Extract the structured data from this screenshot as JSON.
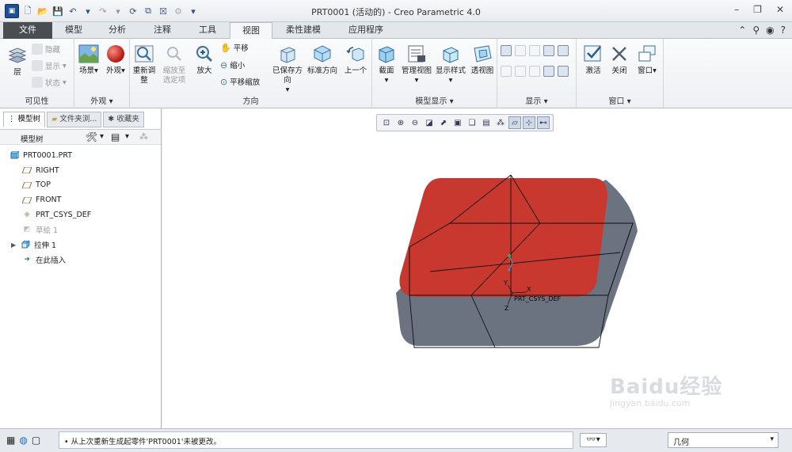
{
  "window": {
    "title": "PRT0001 (活动的) - Creo Parametric 4.0"
  },
  "tabs": [
    {
      "label": "文件"
    },
    {
      "label": "模型"
    },
    {
      "label": "分析"
    },
    {
      "label": "注释"
    },
    {
      "label": "工具"
    },
    {
      "label": "视图"
    },
    {
      "label": "柔性建模"
    },
    {
      "label": "应用程序"
    }
  ],
  "active_tab": "视图",
  "ribbon": {
    "visibility": {
      "label": "可见性",
      "layer": "层",
      "hide": "隐藏",
      "show": "显示",
      "status": "状态"
    },
    "appearance": {
      "label": "外观",
      "scene": "场景",
      "appearance": "外观"
    },
    "orientation": {
      "label": "方向",
      "refit": "重新调整",
      "zoom_selected": "缩放至选定项",
      "zoom_in": "放大",
      "pan": "平移",
      "zoom_out": "缩小",
      "pan_zoom": "平移缩放",
      "saved_orientations": "已保存方向",
      "standard_orientation": "标准方向",
      "previous": "上一个"
    },
    "model_display": {
      "label": "模型显示",
      "section": "截面",
      "manage_views": "管理视图",
      "display_style": "显示样式",
      "perspective": "透视图"
    },
    "show": {
      "label": "显示"
    },
    "window": {
      "label": "窗口",
      "activate": "激活",
      "close": "关闭",
      "windows": "窗口"
    }
  },
  "left_panel": {
    "tabs": [
      {
        "label": "模型树"
      },
      {
        "label": "文件夹浏..."
      },
      {
        "label": "收藏夹"
      }
    ],
    "tree_header": "模型树",
    "tree": [
      {
        "label": "PRT0001.PRT",
        "icon": "part-icon",
        "dim": false
      },
      {
        "label": "RIGHT",
        "icon": "datum-plane-icon",
        "dim": false
      },
      {
        "label": "TOP",
        "icon": "datum-plane-icon",
        "dim": false
      },
      {
        "label": "FRONT",
        "icon": "datum-plane-icon",
        "dim": false
      },
      {
        "label": "PRT_CSYS_DEF",
        "icon": "csys-icon",
        "dim": false
      },
      {
        "label": "草绘 1",
        "icon": "sketch-icon",
        "dim": true
      },
      {
        "label": "拉伸 1",
        "icon": "extrude-icon",
        "dim": false
      },
      {
        "label": "在此插入",
        "icon": "insert-arrow-icon",
        "dim": false
      }
    ]
  },
  "viewport": {
    "csys_label": "PRT_CSYS_DEF",
    "axis_x": "X",
    "axis_y": "Y",
    "axis_z": "Z",
    "colors": {
      "top_face": "#c8382f",
      "side_face": "#6b7380"
    }
  },
  "statusbar": {
    "message": "• 从上次重新生成起零件'PRT0001'未被更改。",
    "filter": "几何"
  },
  "watermark": {
    "brand": "Baidu经验",
    "url": "jingyan.baidu.com"
  }
}
